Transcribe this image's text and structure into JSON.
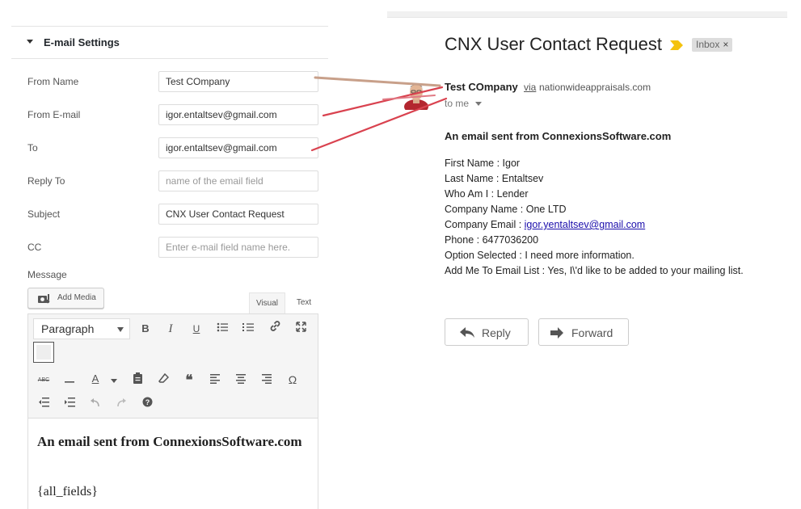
{
  "settings": {
    "section_title": "E-mail Settings",
    "fields": [
      {
        "label": "From Name",
        "value": "Test COmpany",
        "placeholder": ""
      },
      {
        "label": "From E-mail",
        "value": "igor.entaltsev@gmail.com",
        "placeholder": ""
      },
      {
        "label": "To",
        "value": "igor.entaltsev@gmail.com",
        "placeholder": ""
      },
      {
        "label": "Reply To",
        "value": "",
        "placeholder": "name of the email field"
      },
      {
        "label": "Subject",
        "value": "CNX User Contact Request",
        "placeholder": ""
      },
      {
        "label": "CC",
        "value": "",
        "placeholder": "Enter e-mail field name here."
      }
    ],
    "message_label": "Message",
    "add_media_label": "Add Media",
    "tabs": {
      "visual": "Visual",
      "text": "Text"
    },
    "format_select": "Paragraph",
    "toolbar_glyphs": {
      "bold": "B",
      "italic": "I",
      "underline": "U",
      "strikethrough": "ABC",
      "text_color": "A",
      "blockquote": "❝",
      "special_char": "Ω",
      "help": "?"
    },
    "editor": {
      "heading": "An email sent from ConnexionsSoftware.com",
      "fields_tag": "{all_fields}"
    }
  },
  "email": {
    "subject": "CNX User Contact Request",
    "label_chip": "Inbox",
    "chip_close": "×",
    "sender_name": "Test COmpany",
    "via": "via",
    "domain": "nationwideappraisals.com",
    "to": "to me",
    "heading": "An email sent from ConnexionsSoftware.com",
    "lines": [
      {
        "text": "First Name : Igor"
      },
      {
        "text": "Last Name : Entaltsev"
      },
      {
        "text": "Who Am I : Lender"
      },
      {
        "text": "Company Name : One LTD"
      },
      {
        "prefix": "Company Email : ",
        "link": "igor.yentaltsev@gmail.com"
      },
      {
        "text": "Phone : 6477036200"
      },
      {
        "text": "Option Selected : I need more information."
      },
      {
        "text": "Add Me To Email List : Yes, I\\'d like to be added to your mailing list."
      }
    ],
    "reply_label": "Reply",
    "forward_label": "Forward"
  },
  "colors": {
    "annotation_arrow": "#d9424f",
    "annotation_arrow_tan": "#c8a08a",
    "importance": "#f4c20d",
    "link": "#1a0dab"
  }
}
